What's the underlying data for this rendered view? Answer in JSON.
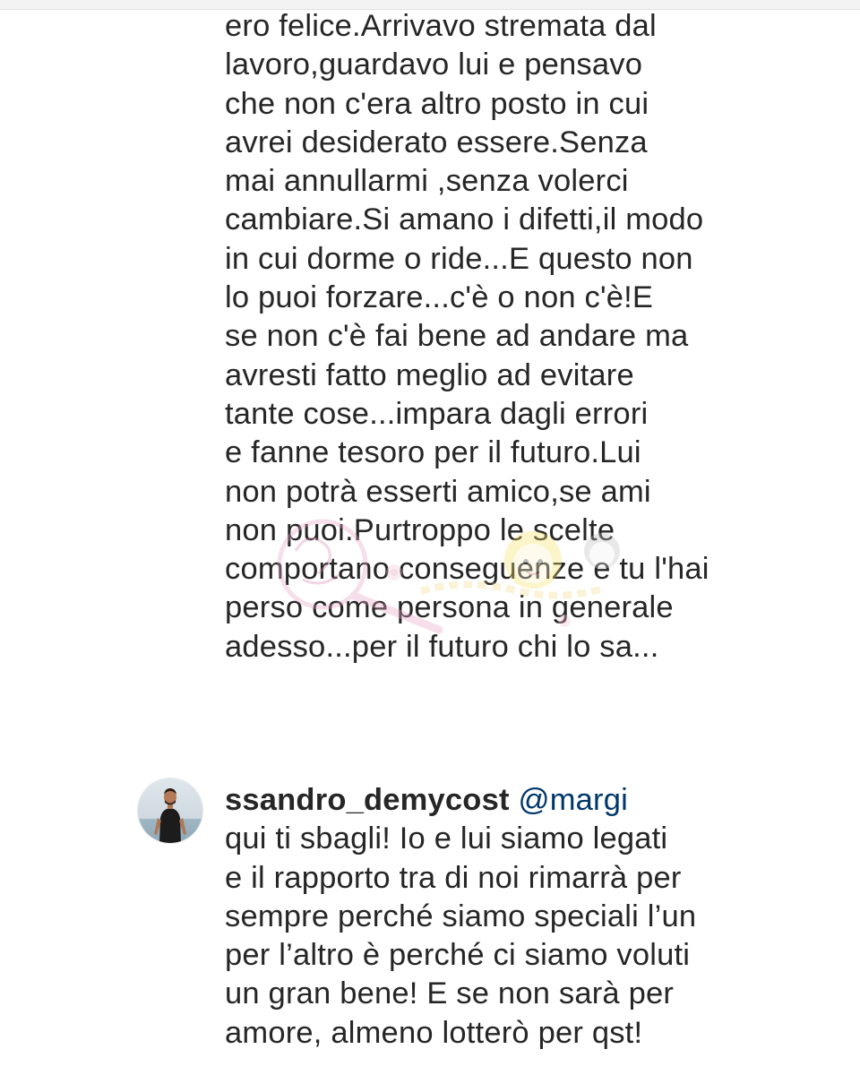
{
  "parent_comment": {
    "lines": [
      "ero felice.Arrivavo stremata dal",
      "lavoro,guardavo lui e pensavo",
      "che non c'era altro posto in cui",
      "avrei desiderato essere.Senza",
      "mai annullarmi ,senza volerci",
      "cambiare.Si amano i difetti,il modo",
      "in cui dorme o ride...E questo non",
      "lo puoi forzare...c'è o non c'è!E",
      "se non c'è fai bene ad andare ma",
      "avresti fatto meglio ad evitare",
      "tante cose...impara dagli errori",
      "e fanne tesoro per il futuro.Lui",
      "non potrà esserti amico,se ami",
      "non puoi.Purtroppo le scelte",
      "comportano conseguenze e tu l'hai",
      "perso come persona in generale",
      "adesso...per il futuro chi lo sa..."
    ]
  },
  "reply": {
    "username": "ssandro_demycost",
    "mention": "@margi",
    "lines": [
      "qui ti sbagli! Io e lui siamo legati",
      "e il rapporto tra di noi rimarrà per",
      "sempre perché siamo speciali l’un",
      "per l’altro è perché ci siamo voluti",
      "un gran bene! E se non sarà per",
      "amore, almeno lotterò per qst!"
    ]
  },
  "colors": {
    "text": "#262626",
    "mention": "#00376b",
    "background": "#ffffff"
  },
  "icons": {
    "avatar": "user-avatar",
    "watermark": "magnifier-logo-watermark"
  }
}
